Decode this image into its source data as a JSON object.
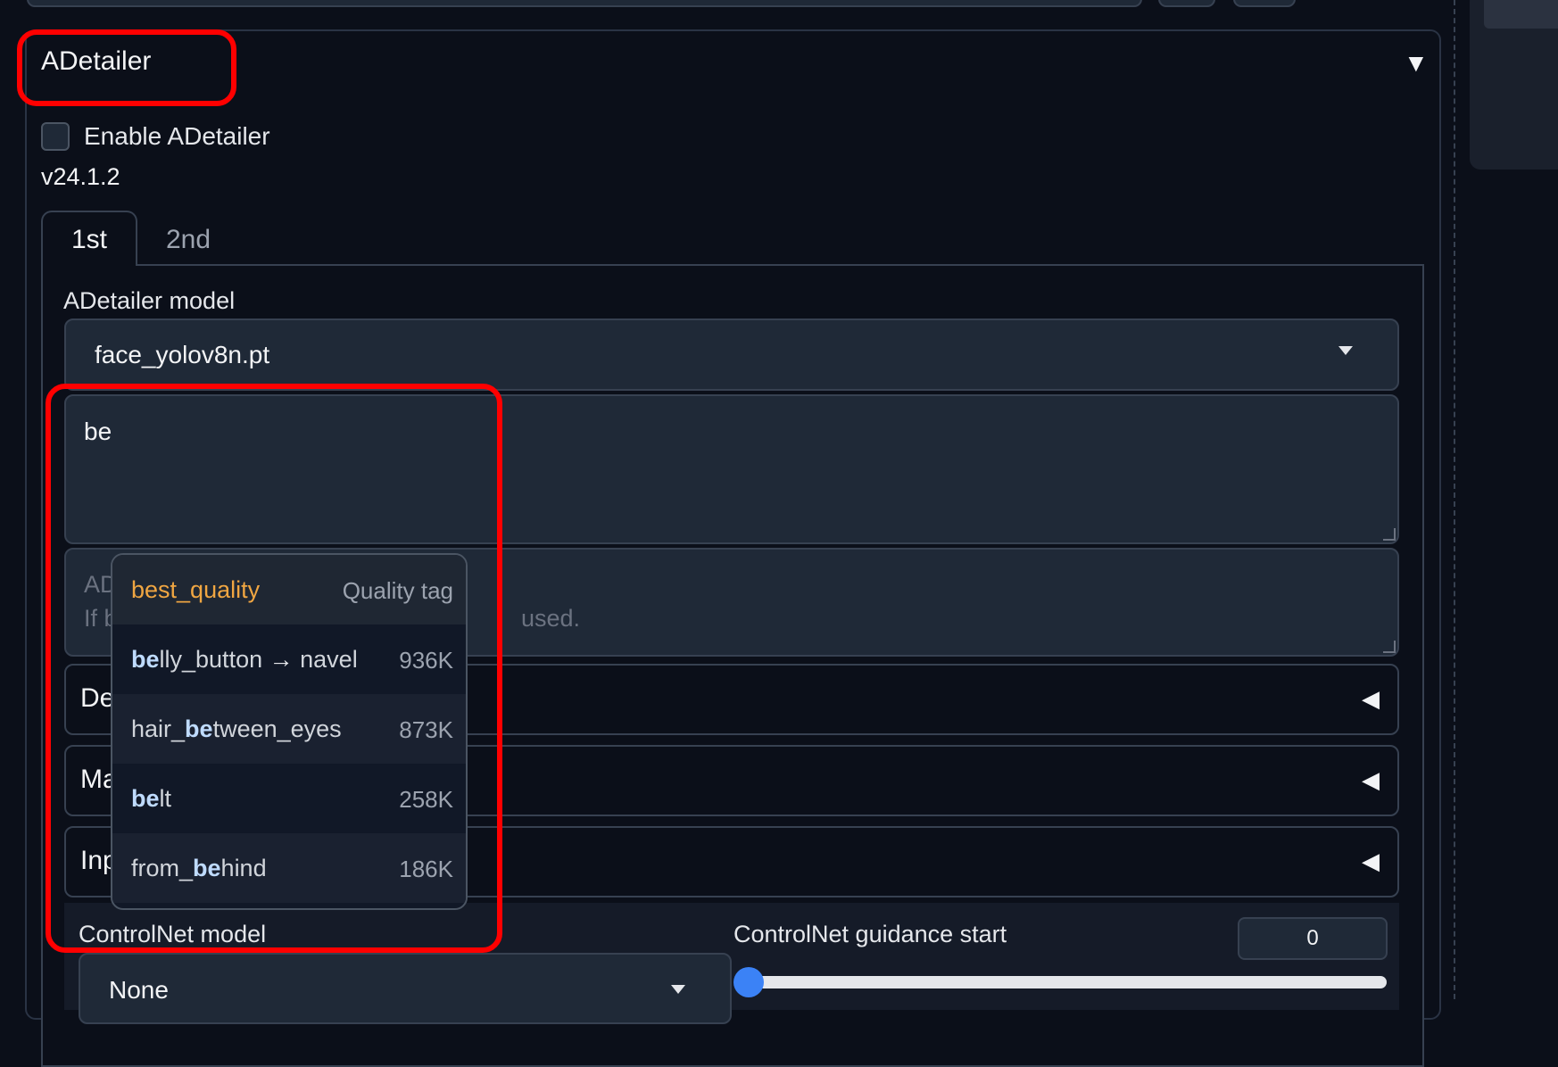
{
  "accordion": {
    "title": "ADetailer",
    "arrow": "▼",
    "enable_label": "Enable ADetailer",
    "version": "v24.1.2"
  },
  "tabs": [
    {
      "label": "1st",
      "active": true
    },
    {
      "label": "2nd",
      "active": false
    }
  ],
  "model": {
    "label": "ADetailer model",
    "value": "face_yolov8n.pt"
  },
  "prompt": {
    "value": "be"
  },
  "negative_prompt": {
    "placeholder_line1": "AD",
    "placeholder_line2": "If b",
    "placeholder_tail": "used."
  },
  "sub_accordions": [
    {
      "label": "De",
      "arrow": "◀"
    },
    {
      "label": "Ma",
      "arrow": "◀"
    },
    {
      "label": "Inp",
      "arrow": "◀"
    }
  ],
  "controlnet": {
    "model_label": "ControlNet model",
    "model_value": "None",
    "guidance_start_label": "ControlNet guidance start",
    "guidance_start_value": "0",
    "guidance_start_fraction": 0
  },
  "autocomplete": {
    "items": [
      {
        "prefix": "",
        "match": "",
        "suffix": "best_quality",
        "meta": "Quality tag"
      },
      {
        "prefix": "",
        "match": "be",
        "suffix": "lly_button",
        "alias_arrow": "→",
        "alias": "navel",
        "meta": "936K"
      },
      {
        "prefix": "hair_",
        "match": "be",
        "suffix": "tween_eyes",
        "meta": "873K"
      },
      {
        "prefix": "",
        "match": "be",
        "suffix": "lt",
        "meta": "258K"
      },
      {
        "prefix": "from_",
        "match": "be",
        "suffix": "hind",
        "meta": "186K"
      }
    ]
  },
  "colors": {
    "background": "#0b0f19",
    "annotation_red": "#ff0000",
    "quality_tag": "#f0a642",
    "slider_thumb": "#3b82f6"
  }
}
